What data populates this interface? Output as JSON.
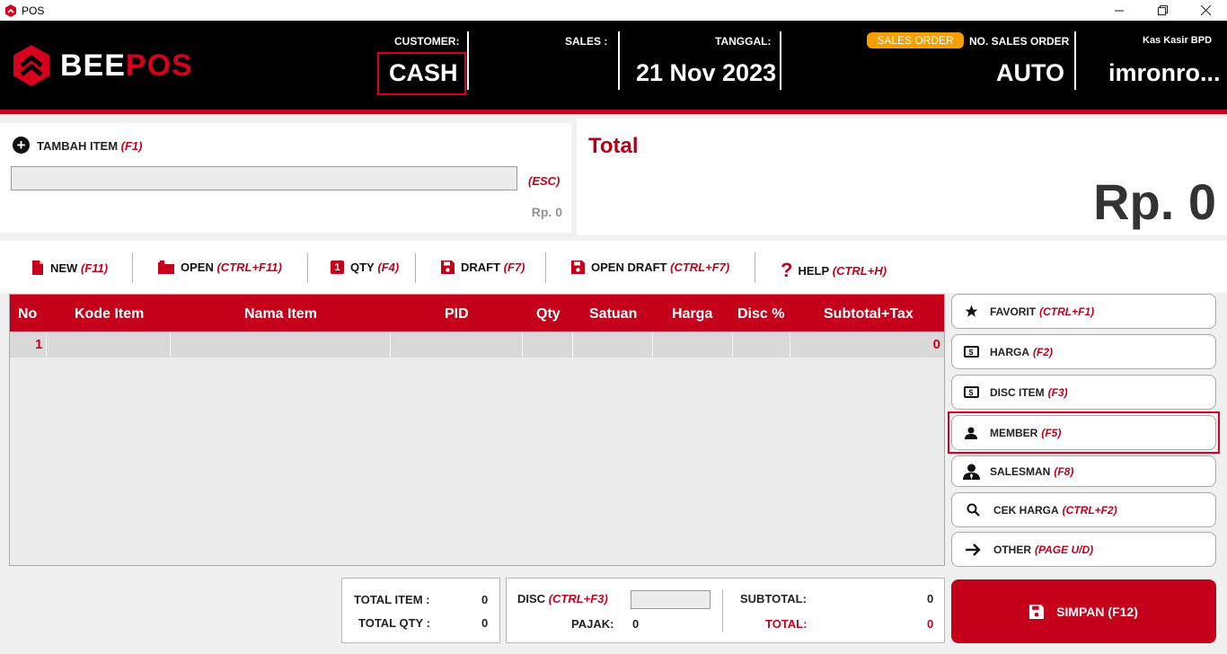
{
  "window": {
    "title": "POS"
  },
  "header": {
    "logo_bee": "BEE",
    "logo_pos": "POS",
    "customer_label": "CUSTOMER:",
    "customer_value": "CASH",
    "sales_label": "SALES :",
    "sales_value": "",
    "tanggal_label": "TANGGAL:",
    "tanggal_value": "21 Nov 2023",
    "sales_order_badge": "SALES ORDER",
    "no_sales_order_label": "NO. SALES ORDER",
    "no_sales_order_value": "AUTO",
    "kasir_label": "Kas Kasir BPD",
    "kasir_value": "imronro..."
  },
  "add_item": {
    "label": "TAMBAH ITEM",
    "shortcut": "(F1)",
    "input_value": "",
    "esc_label": "(ESC)",
    "price": "Rp. 0"
  },
  "total": {
    "title": "Total",
    "value": "Rp. 0"
  },
  "toolbar": [
    {
      "label": "NEW",
      "shortcut": "(F11)",
      "icon": "file-icon"
    },
    {
      "label": "OPEN",
      "shortcut": "(CTRL+F11)",
      "icon": "folder-icon"
    },
    {
      "label": "QTY",
      "shortcut": "(F4)",
      "icon": "qty-icon",
      "icon_text": "1"
    },
    {
      "label": "DRAFT",
      "shortcut": "(F7)",
      "icon": "floppy-icon"
    },
    {
      "label": "OPEN DRAFT",
      "shortcut": "(CTRL+F7)",
      "icon": "floppy-icon"
    },
    {
      "label": "HELP",
      "shortcut": "(CTRL+H)",
      "icon": "question-icon",
      "icon_text": "?"
    }
  ],
  "grid": {
    "columns": [
      "No",
      "Kode Item",
      "Nama Item",
      "PID",
      "Qty",
      "Satuan",
      "Harga",
      "Disc %",
      "Subtotal+Tax"
    ],
    "rows": [
      {
        "no": "1",
        "kode": "",
        "nama": "",
        "pid": "",
        "qty": "",
        "satuan": "",
        "harga": "",
        "disc": "",
        "subtotal": "0"
      }
    ]
  },
  "side_buttons": [
    {
      "label": "FAVORIT",
      "shortcut": "(CTRL+F1)",
      "icon": "star-icon"
    },
    {
      "label": "HARGA",
      "shortcut": "(F2)",
      "icon": "money-icon",
      "icon_text": "$"
    },
    {
      "label": "DISC ITEM",
      "shortcut": "(F3)",
      "icon": "money-icon",
      "icon_text": "$"
    },
    {
      "label": "MEMBER",
      "shortcut": "(F5)",
      "icon": "user-icon"
    },
    {
      "label": "SALESMAN",
      "shortcut": "(F8)",
      "icon": "salesman-icon"
    },
    {
      "label": "CEK HARGA",
      "shortcut": "(CTRL+F2)",
      "icon": "search-icon"
    },
    {
      "label": "OTHER",
      "shortcut": "(PAGE U/D)",
      "icon": "arrow-right-icon"
    }
  ],
  "summary": {
    "total_item_label": "TOTAL ITEM :",
    "total_item_value": "0",
    "total_qty_label": "TOTAL QTY :",
    "total_qty_value": "0",
    "disc_label": "DISC",
    "disc_shortcut": "(CTRL+F3)",
    "disc_value": "",
    "pajak_label": "PAJAK:",
    "pajak_value": "0",
    "subtotal_label": "SUBTOTAL:",
    "subtotal_value": "0",
    "total_label": "TOTAL:",
    "total_value": "0"
  },
  "save_button": {
    "label": "SIMPAN (F12)",
    "icon": "floppy-icon"
  },
  "colors": {
    "brand_red": "#c4001a",
    "badge_orange": "#f5a000",
    "header_bg": "#000000"
  }
}
